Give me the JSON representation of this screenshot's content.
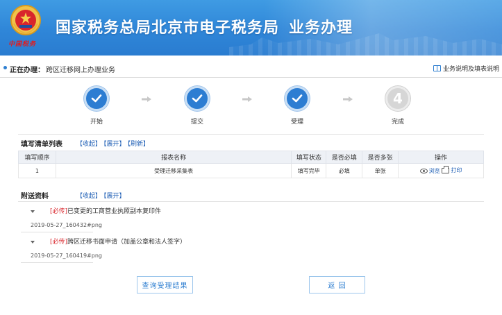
{
  "header": {
    "title": "国家税务总局北京市电子税务局",
    "subtitle": "业务办理",
    "emblem_caption": "中国税务",
    "emblem_icon": "tax-emblem-icon"
  },
  "current_task": {
    "label": "正在办理：",
    "value": "跨区迁移网上办理业务",
    "help_link": "业务说明及填表说明",
    "help_icon": "book-icon"
  },
  "steps": [
    {
      "label": "开始",
      "status": "done",
      "icon": "check-icon"
    },
    {
      "label": "提交",
      "status": "done",
      "icon": "check-icon"
    },
    {
      "label": "受理",
      "status": "done",
      "icon": "check-icon"
    },
    {
      "label": "完成",
      "status": "pending",
      "number": "4"
    }
  ],
  "form_list": {
    "title": "填写清单列表",
    "links": [
      "【收起】",
      "【展开】",
      "【刷新】"
    ],
    "columns": [
      "填写顺序",
      "报表名称",
      "填写状态",
      "是否必填",
      "是否多张",
      "操作"
    ],
    "rows": [
      {
        "order": "1",
        "name": "受理迁移采集表",
        "status": "填写完毕",
        "required": "必填",
        "multiple": "单张",
        "preview": "浏览",
        "print": "打印"
      }
    ]
  },
  "attachments": {
    "title": "附送资料",
    "links": [
      "【收起】",
      "【展开】"
    ],
    "items": [
      {
        "tag": "[必传]",
        "name": "已变更的工商营业执照副本复印件",
        "file": "2019-05-27_160432#png"
      },
      {
        "tag": "[必传]",
        "name": "跨区迁移书面申请（加盖公章和法人签字）",
        "file": "2019-05-27_160419#png"
      }
    ]
  },
  "buttons": {
    "query": "查询受理结果",
    "back": "返 回"
  },
  "colors": {
    "banner": "#2f86d8",
    "accent": "#2d7dd2",
    "link": "#1f5fb5",
    "required": "#d9242a"
  }
}
